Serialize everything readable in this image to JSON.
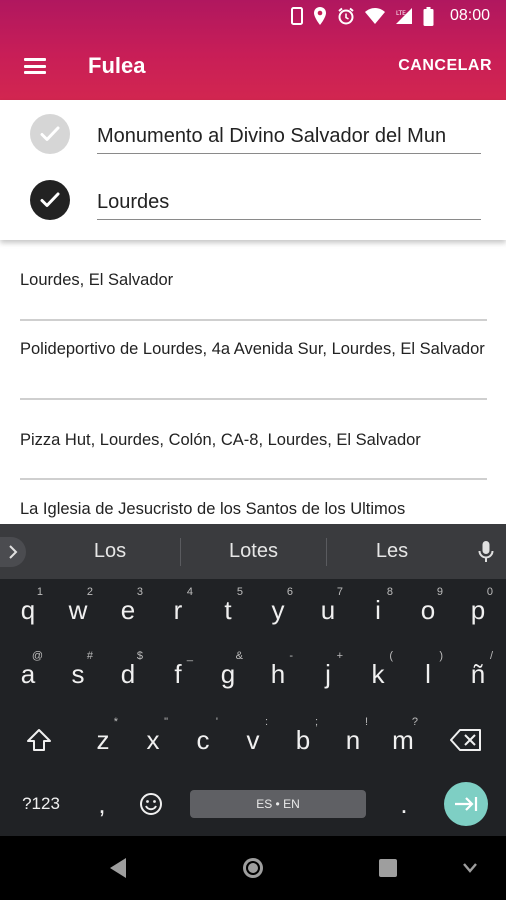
{
  "status_bar": {
    "time": "08:00",
    "icons": [
      "phone-icon",
      "location-icon",
      "alarm-icon",
      "wifi-icon",
      "lte-signal-icon",
      "battery-icon"
    ]
  },
  "app_bar": {
    "title": "Fulea",
    "cancel_label": "CANCELAR",
    "menu_icon": "hamburger-menu-icon",
    "background": "#c81e57"
  },
  "route": {
    "origin": {
      "value": "Monumento al Divino Salvador del Mun",
      "icon": "check-circle-icon",
      "state": "inactive"
    },
    "destination": {
      "value": "Lourdes",
      "icon": "check-circle-icon",
      "state": "active"
    }
  },
  "results": [
    {
      "label": "Lourdes, El Salvador"
    },
    {
      "label": "Polideportivo de Lourdes, 4a Avenida Sur, Lourdes, El Salvador"
    },
    {
      "label": "Pizza Hut, Lourdes, Colón, CA-8, Lourdes, El Salvador"
    },
    {
      "label": "La Iglesia de Jesucristo de los Santos de los Ultimos"
    }
  ],
  "keyboard": {
    "suggestions": [
      "Los",
      "Lotes",
      "Les"
    ],
    "row1": [
      {
        "key": "q",
        "hint": "1"
      },
      {
        "key": "w",
        "hint": "2"
      },
      {
        "key": "e",
        "hint": "3"
      },
      {
        "key": "r",
        "hint": "4"
      },
      {
        "key": "t",
        "hint": "5"
      },
      {
        "key": "y",
        "hint": "6"
      },
      {
        "key": "u",
        "hint": "7"
      },
      {
        "key": "i",
        "hint": "8"
      },
      {
        "key": "o",
        "hint": "9"
      },
      {
        "key": "p",
        "hint": "0"
      }
    ],
    "row2": [
      {
        "key": "a",
        "hint": "@"
      },
      {
        "key": "s",
        "hint": "#"
      },
      {
        "key": "d",
        "hint": "$"
      },
      {
        "key": "f",
        "hint": "_"
      },
      {
        "key": "g",
        "hint": "&"
      },
      {
        "key": "h",
        "hint": "-"
      },
      {
        "key": "j",
        "hint": "+"
      },
      {
        "key": "k",
        "hint": "("
      },
      {
        "key": "l",
        "hint": ")"
      },
      {
        "key": "ñ",
        "hint": "/"
      }
    ],
    "row3": [
      {
        "key": "z",
        "hint": "*"
      },
      {
        "key": "x",
        "hint": "\""
      },
      {
        "key": "c",
        "hint": "'"
      },
      {
        "key": "v",
        "hint": ":"
      },
      {
        "key": "b",
        "hint": ";"
      },
      {
        "key": "n",
        "hint": "!"
      },
      {
        "key": "m",
        "hint": "?"
      }
    ],
    "symbols_label": "?123",
    "comma_label": ",",
    "period_label": ".",
    "space_label": "ES • EN",
    "enter_color": "#7ecfc4"
  },
  "nav_bar": {
    "buttons": [
      "back-icon",
      "home-icon",
      "recents-icon",
      "keyboard-hide-icon"
    ]
  }
}
